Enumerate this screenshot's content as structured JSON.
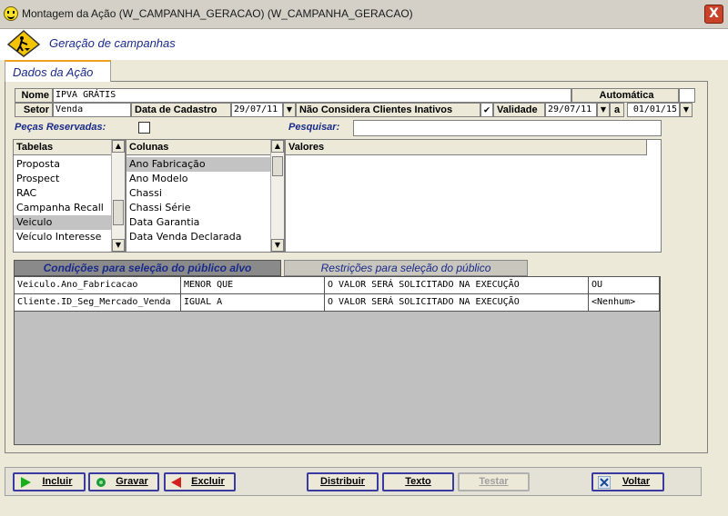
{
  "window": {
    "title": "Montagem da Ação (W_CAMPANHA_GERACAO) (W_CAMPANHA_GERACAO)",
    "close": "X"
  },
  "header": {
    "title": "Geração de campanhas",
    "icon": "construction-sign-icon"
  },
  "tab": {
    "label": "Dados da Ação"
  },
  "form": {
    "nome_label": "Nome",
    "nome_value": "IPVA GRÁTIS",
    "automatica_label": "Automática",
    "setor_label": "Setor",
    "setor_value": "Venda",
    "data_cadastro_label": "Data de Cadastro",
    "data_cadastro_value": "29/07/11",
    "nao_considera_label": "Não Considera Clientes Inativos",
    "check_mark": "✔",
    "validade_label": "Validade",
    "validade_from": "29/07/11",
    "validade_sep": "a",
    "validade_to": "01/01/15",
    "pecas_label": "Peças Reservadas:",
    "pesquisar_label": "Pesquisar:",
    "pesquisar_value": ""
  },
  "tabelas": {
    "header": "Tabelas",
    "items": [
      "Proposta",
      "Prospect",
      "RAC",
      "Campanha Recall",
      "Veiculo",
      "Veículo Interesse"
    ],
    "selected": 4
  },
  "colunas": {
    "header": "Colunas",
    "items": [
      "Ano Fabricação",
      "Ano Modelo",
      "Chassi",
      "Chassi Série",
      "Data Garantia",
      "Data Venda Declarada"
    ],
    "selected": 0
  },
  "valores": {
    "header": "Valores"
  },
  "lower_tabs": [
    "Condições para seleção do público alvo",
    "Restrições para seleção do público"
  ],
  "conditions": [
    {
      "campo": "Veiculo.Ano_Fabricacao",
      "operador": "MENOR QUE",
      "valor": "O VALOR SERÁ SOLICITADO NA EXECUÇÃO",
      "logico": "OU"
    },
    {
      "campo": "Cliente.ID_Seg_Mercado_Venda",
      "operador": "IGUAL A",
      "valor": "O VALOR SERÁ SOLICITADO NA EXECUÇÃO",
      "logico": "<Nenhum>"
    }
  ],
  "buttons": {
    "incluir": "Incluir",
    "gravar": "Gravar",
    "excluir": "Excluir",
    "distribuir": "Distribuir",
    "texto": "Texto",
    "testar": "Testar",
    "voltar": "Voltar"
  }
}
